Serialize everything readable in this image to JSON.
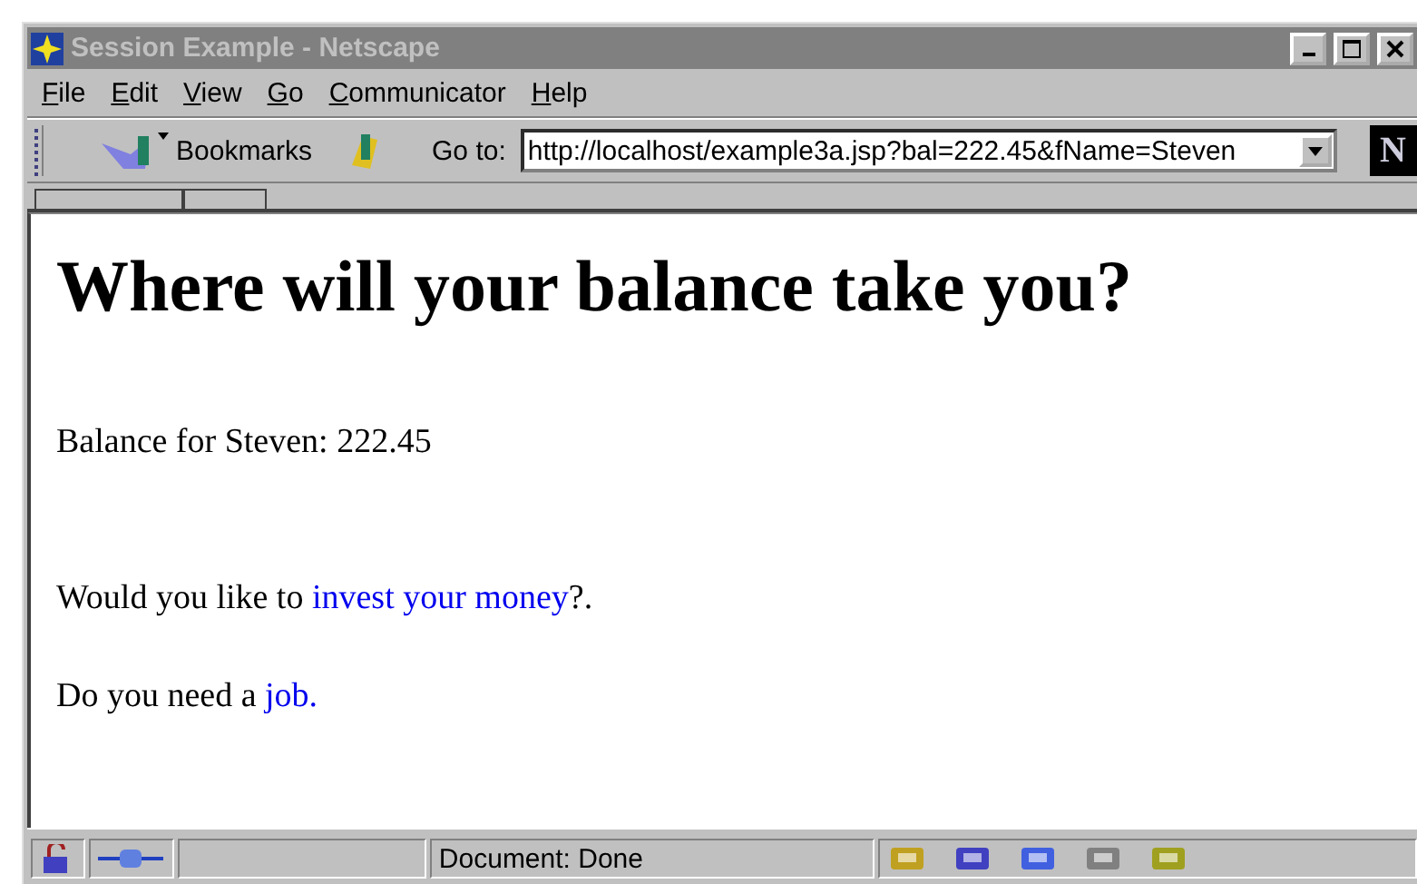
{
  "window": {
    "title": "Session Example - Netscape",
    "active": false
  },
  "menu": [
    {
      "accel": "F",
      "rest": "ile"
    },
    {
      "accel": "E",
      "rest": "dit"
    },
    {
      "accel": "V",
      "rest": "iew"
    },
    {
      "accel": "G",
      "rest": "o"
    },
    {
      "accel": "C",
      "rest": "ommunicator"
    },
    {
      "accel": "H",
      "rest": "elp"
    }
  ],
  "toolbar": {
    "bookmarks": "Bookmarks",
    "goto_label": "Go to:",
    "url": "http://localhost/example3a.jsp?bal=222.45&fName=Steven",
    "logo_letter": "N"
  },
  "page": {
    "heading": "Where will your balance take you?",
    "balance": "Balance for Steven: 222.45",
    "lines": [
      {
        "before": "Would you like to ",
        "link": "invest your money",
        "after": "?."
      },
      {
        "before": "Do you need a ",
        "link": "job."
      }
    ]
  },
  "status_bar": {
    "text": "Document: Done"
  }
}
